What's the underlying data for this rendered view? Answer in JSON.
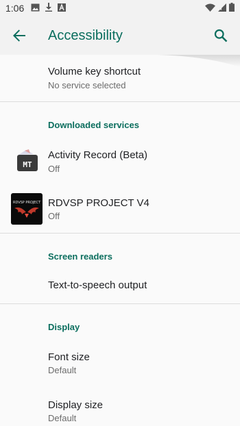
{
  "status_bar": {
    "time": "1:06"
  },
  "app_bar": {
    "title": "Accessibility"
  },
  "items": {
    "volume_key": {
      "title": "Volume key shortcut",
      "subtitle": "No service selected"
    },
    "activity_record": {
      "title": "Activity Record (Beta)",
      "subtitle": "Off",
      "icon_label": "MT"
    },
    "rdvsp": {
      "title": "RDVSP PROJECT V4",
      "subtitle": "Off",
      "icon_label": "RDVSP PROJECT"
    },
    "tts": {
      "title": "Text-to-speech output"
    },
    "font_size": {
      "title": "Font size",
      "subtitle": "Default"
    },
    "display_size": {
      "title": "Display size",
      "subtitle": "Default"
    }
  },
  "sections": {
    "downloaded": "Downloaded services",
    "screen_readers": "Screen readers",
    "display": "Display"
  },
  "colors": {
    "accent": "#0b6e5e",
    "background": "#fafafa",
    "bar": "#f2f2f2"
  }
}
